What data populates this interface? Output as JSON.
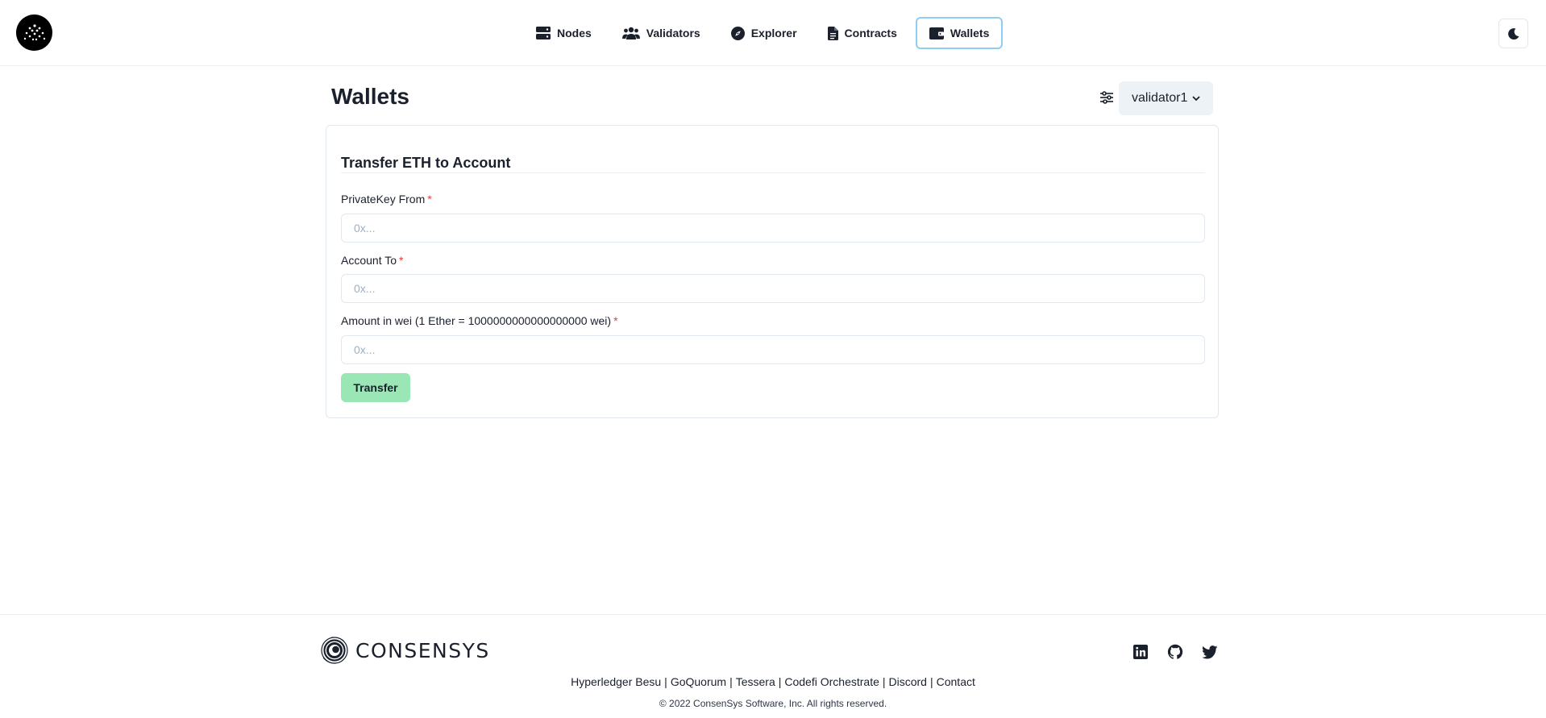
{
  "nav": {
    "items": [
      {
        "label": "Nodes",
        "icon": "server-icon"
      },
      {
        "label": "Validators",
        "icon": "users-icon"
      },
      {
        "label": "Explorer",
        "icon": "compass-icon"
      },
      {
        "label": "Contracts",
        "icon": "file-icon"
      },
      {
        "label": "Wallets",
        "icon": "wallet-icon",
        "active": true
      }
    ]
  },
  "page": {
    "title": "Wallets",
    "node_select": "validator1"
  },
  "form": {
    "title": "Transfer ETH to Account",
    "fields": [
      {
        "label": "PrivateKey From",
        "required_mark": "*",
        "placeholder": "0x...",
        "value": ""
      },
      {
        "label": "Account To",
        "required_mark": "*",
        "placeholder": "0x...",
        "value": ""
      },
      {
        "label": "Amount in wei (1 Ether = 1000000000000000000 wei)",
        "required_mark": "*",
        "placeholder": "0x...",
        "value": ""
      }
    ],
    "submit_label": "Transfer"
  },
  "footer": {
    "brand": "CONSENSYS",
    "links": [
      "Hyperledger Besu",
      "GoQuorum",
      "Tessera",
      "Codefi Orchestrate",
      "Discord",
      "Contact"
    ],
    "separator": "|",
    "copyright": "© 2022 ConsenSys Software, Inc. All rights reserved."
  },
  "colors": {
    "accent_border": "#90cdf4",
    "transfer_button": "#9ae6b4",
    "required": "#e53e3e",
    "select_bg": "#edf2f7"
  }
}
